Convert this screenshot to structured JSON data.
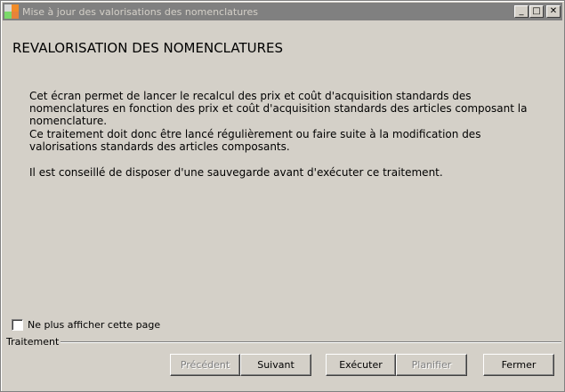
{
  "window": {
    "title": "Mise à jour des valorisations des nomenclatures",
    "icon": "app-icon",
    "controls": {
      "minimize": "_",
      "maximize": "□",
      "close": "✕"
    }
  },
  "heading": "REVALORISATION DES NOMENCLATURES",
  "paragraphs": [
    "Cet écran permet de lancer le recalcul des prix et coût d'acquisition standards des nomenclatures en fonction des prix et coût d'acquisition standards des articles composant la nomenclature.",
    "Ce traitement doit donc être lancé régulièrement ou faire suite à la modification des valorisations standards des articles composants.",
    "Il est conseillé de disposer d'une sauvegarde avant d'exécuter ce traitement."
  ],
  "checkbox": {
    "label": "Ne plus afficher cette page",
    "checked": false
  },
  "group": {
    "label": "Traitement"
  },
  "buttons": {
    "precedent": {
      "label": "Précédent",
      "enabled": false
    },
    "suivant": {
      "label": "Suivant",
      "enabled": true
    },
    "executer": {
      "label": "Exécuter",
      "enabled": true
    },
    "planifier": {
      "label": "Planifier",
      "enabled": false
    },
    "fermer": {
      "label": "Fermer",
      "enabled": true
    }
  },
  "colors": {
    "titlebar_inactive": "#808080",
    "face": "#d4d0c8",
    "disabled_text": "#808080"
  }
}
